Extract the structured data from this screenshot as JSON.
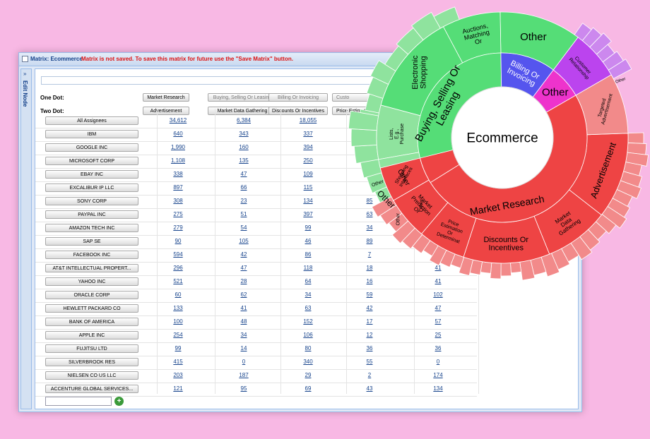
{
  "window": {
    "title": "Matrix: Ecommerce",
    "warning": "Matrix is not saved. To save this matrix for future use the \"Save Matrix\" button.",
    "side_label": "Edit Node"
  },
  "one_dot": {
    "label": "One Dot:",
    "buttons": [
      "Market Research",
      "Buying, Selling Or Leasing",
      "Billing Or Invoicing",
      "Custo"
    ]
  },
  "two_dot": {
    "label": "Two Dot:",
    "buttons": [
      "Advertisement",
      "Market Data Gathering",
      "Discounts Or Incentives",
      "Price Estimation"
    ]
  },
  "rows": [
    {
      "name": "All Assignees",
      "values": [
        "34,612",
        "6,384",
        "18,055",
        "5,"
      ]
    },
    {
      "name": "IBM",
      "values": [
        "640",
        "343",
        "337",
        ""
      ]
    },
    {
      "name": "GOOGLE INC",
      "values": [
        "1,990",
        "160",
        "394",
        ""
      ]
    },
    {
      "name": "MICROSOFT CORP",
      "values": [
        "1,108",
        "135",
        "250",
        ""
      ]
    },
    {
      "name": "EBAY INC",
      "values": [
        "338",
        "47",
        "109",
        ""
      ]
    },
    {
      "name": "EXCALIBUR IP LLC",
      "values": [
        "897",
        "66",
        "115",
        ""
      ]
    },
    {
      "name": "SONY CORP",
      "values": [
        "308",
        "23",
        "134",
        "85"
      ]
    },
    {
      "name": "PAYPAL INC",
      "values": [
        "275",
        "51",
        "397",
        "63"
      ]
    },
    {
      "name": "AMAZON TECH INC",
      "values": [
        "279",
        "54",
        "99",
        "34"
      ]
    },
    {
      "name": "SAP SE",
      "values": [
        "90",
        "105",
        "46",
        "89"
      ]
    },
    {
      "name": "FACEBOOK INC",
      "values": [
        "594",
        "42",
        "86",
        "7"
      ]
    },
    {
      "name": "AT&T INTELLECTUAL PROPERT...",
      "values": [
        "296",
        "47",
        "118",
        "18",
        "41"
      ]
    },
    {
      "name": "YAHOO INC",
      "values": [
        "521",
        "28",
        "64",
        "16",
        "41"
      ]
    },
    {
      "name": "ORACLE CORP",
      "values": [
        "60",
        "62",
        "34",
        "59",
        "102"
      ]
    },
    {
      "name": "HEWLETT PACKARD CO",
      "values": [
        "133",
        "41",
        "63",
        "42",
        "47"
      ]
    },
    {
      "name": "BANK OF AMERICA",
      "values": [
        "100",
        "48",
        "152",
        "17",
        "57"
      ]
    },
    {
      "name": "APPLE INC",
      "values": [
        "254",
        "34",
        "106",
        "12",
        "25"
      ]
    },
    {
      "name": "FUJITSU LTD",
      "values": [
        "99",
        "14",
        "80",
        "36",
        "36"
      ]
    },
    {
      "name": "SILVERBROOK RES",
      "values": [
        "415",
        "0",
        "340",
        "55",
        "0"
      ]
    },
    {
      "name": "NIELSEN CO US LLC",
      "values": [
        "203",
        "187",
        "29",
        "2",
        "174"
      ]
    },
    {
      "name": "ACCENTURE GLOBAL SERVICES...",
      "values": [
        "121",
        "95",
        "69",
        "43",
        "134"
      ]
    }
  ],
  "add_button": "+",
  "sunburst": {
    "center": "Ecommerce",
    "inner": [
      {
        "label": [
          "Buying, Selling Or",
          "Leasing"
        ],
        "color": "#55dd77"
      },
      {
        "label": [
          "Billing Or",
          "Invoicing"
        ],
        "color": "#5555ee"
      },
      {
        "label": [
          "Other"
        ],
        "color": "#ee33cc"
      },
      {
        "label": [
          "Market Research"
        ],
        "color": "#ee4444"
      }
    ],
    "middle": [
      {
        "label": [
          "Other"
        ]
      },
      {
        "label": [
          "Auctions,",
          "Matching",
          "Or"
        ]
      },
      {
        "label": [
          "Electronic",
          "Shopping"
        ]
      },
      {
        "label": [
          "Lists,",
          "E.g.,",
          "Purchase"
        ]
      },
      {
        "label": [
          "Shopping",
          "Interfaces"
        ]
      },
      {
        "label": [
          "Other"
        ]
      },
      {
        "label": [
          "Customer",
          "Relationship"
        ]
      },
      {
        "label": [
          "Advertisement"
        ]
      },
      {
        "label": [
          "Market",
          "Data",
          "Gathering"
        ]
      },
      {
        "label": [
          "Discounts Or",
          "Incentives"
        ]
      },
      {
        "label": [
          "Price",
          "Estimation",
          "Or",
          "Determinat"
        ]
      },
      {
        "label": [
          "Market",
          "Prediction",
          "Or"
        ]
      },
      {
        "label": [
          "Other"
        ]
      },
      {
        "label": [
          "Targeted",
          "Advertisement"
        ]
      }
    ],
    "outer_other": [
      "Other",
      "Other",
      "Other",
      "Other"
    ],
    "colors": {
      "green": "#55dd77",
      "blue": "#5555ee",
      "purple": "#bb44ee",
      "magenta": "#ee33cc",
      "red": "#ee4444",
      "lightgreen": "#8fe39e",
      "lightred": "#f28a8a",
      "lightpurple": "#cc88ee"
    }
  }
}
